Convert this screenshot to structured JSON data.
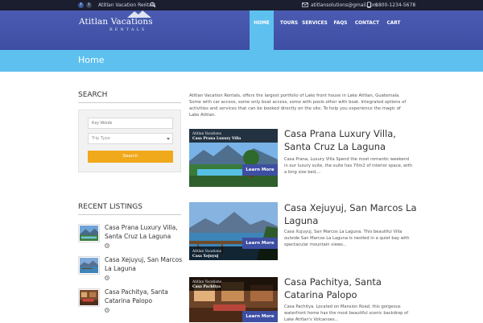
{
  "topbar": {
    "site_name": "Atitlan Vacation Rentals",
    "email": "atitlansolutions@gmail.com",
    "phone": "1800-1234-5678"
  },
  "logo": {
    "line1": "Atitlan Vacations",
    "line2": "RENTALS"
  },
  "nav": [
    {
      "label": "HOME",
      "active": true
    },
    {
      "label": "TOURS"
    },
    {
      "label": "SERVICES"
    },
    {
      "label": "FAQS"
    },
    {
      "label": "CONTACT"
    },
    {
      "label": "CART"
    }
  ],
  "page_title": "Home",
  "sidebar": {
    "search_title": "SEARCH",
    "keywords_placeholder": "Key Words",
    "trip_type": "Trip Type",
    "search_button": "Search",
    "recent_title": "RECENT LISTINGS",
    "recent": [
      {
        "title": "Casa Prana Luxury Villa, Santa Cruz La Laguna"
      },
      {
        "title": "Casa Xejuyuj, San Marcos La Laguna"
      },
      {
        "title": "Casa Pachitya, Santa Catarina Palopo"
      }
    ]
  },
  "intro": "Atitlan Vacation Rentals, offers the largest portfolio of Lake front house in Lake Atitlan, Guatemala. Some with car access, some only boat access, some with pools other with boat. Integrated options of activities and services that can be booked directly on the site. To help you experience the magic of Lake Atitlan.",
  "listings": [
    {
      "brand": "Atitlan Vacations",
      "brand_sub": "Casa Prana Luxury Villa",
      "more": "Learn More",
      "title": "Casa Prana Luxury Villa, Santa Cruz La Laguna",
      "desc": "Casa Prana, Luxury Villa Spend the most romantic weekend in our luxury suite, the suite has 70m2 of interior space, with a king size bed,..."
    },
    {
      "brand": "Atitlan Vacations",
      "brand_sub": "Casa Xejuyuj",
      "more": "Learn More",
      "title": "Casa Xejuyuj, San Marcos La Laguna",
      "desc": "Casa Xujuyuj, San Marcos La Laguna. This beautiful Villa outside San Marcos La Laguna is nestled in a quiet bay with spectacular mountain views..."
    },
    {
      "brand": "Atitlan Vacations",
      "brand_sub": "Casa Pachitya",
      "more": "Learn More",
      "title": "Casa Pachitya, Santa Catarina Palopo",
      "desc": "Casa Pachitya. Located on Mansion Road, this gorgeous waterfront home has the most beautiful scenic backdrop of Lake Atitlan's Volcanoes..."
    }
  ]
}
